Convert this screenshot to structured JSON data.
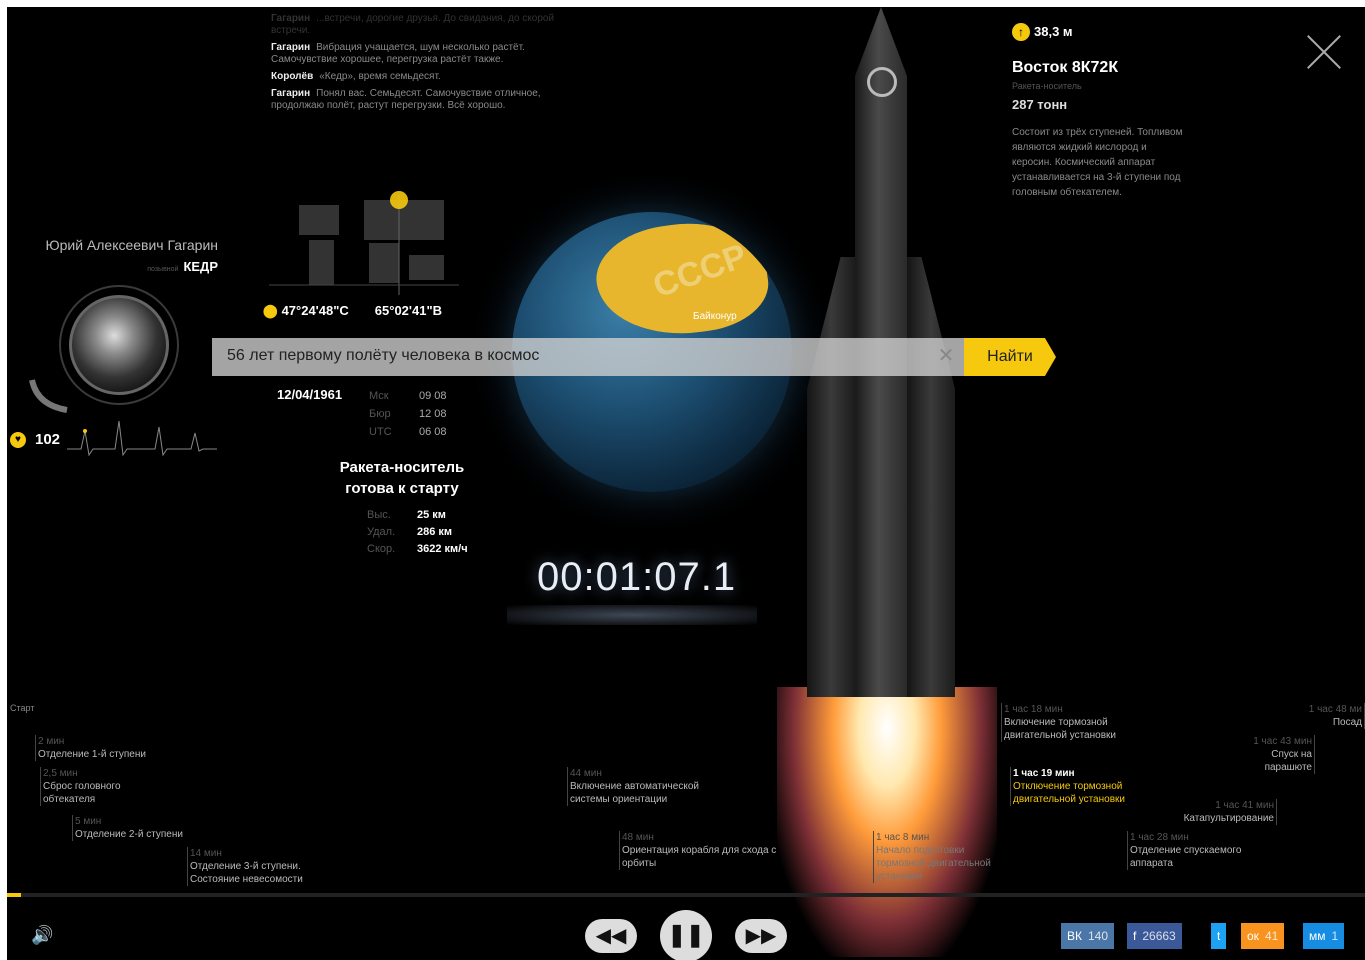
{
  "chat": [
    {
      "who": "Гагарин",
      "text": "...встречи, дорогие друзья. До свидания, до скорой встречи.",
      "faded": true
    },
    {
      "who": "Гагарин",
      "text": "Вибрация учащается, шум несколько растёт. Самочувствие хорошее, перегрузка растёт также.",
      "faded": false
    },
    {
      "who": "Королёв",
      "text": "«Кедр», время семьдесят.",
      "faded": false
    },
    {
      "who": "Гагарин",
      "text": "Понял вас. Семьдесят. Самочувствие отличное, продолжаю полёт, растут перегрузки. Всё хорошо.",
      "faded": false
    }
  ],
  "pilot": {
    "name": "Юрий Алексеевич Гагарин",
    "callsign_label": "позывной",
    "callsign": "КЕДР",
    "heart_rate": "102"
  },
  "coords": {
    "lat": "47°24'48\"С",
    "lon": "65°02'41\"В"
  },
  "globe": {
    "country_label": "СССР",
    "site_label": "Байконур"
  },
  "search": {
    "query": "56 лет первому полёту человека в космос",
    "button": "Найти"
  },
  "time": {
    "date": "12/04/1961",
    "zones": [
      {
        "label": "Мск",
        "value": "09 08"
      },
      {
        "label": "Бюр",
        "value": "12 08"
      },
      {
        "label": "UTC",
        "value": "06 08"
      }
    ]
  },
  "status": {
    "line1": "Ракета-носитель",
    "line2": "готова к старту",
    "stats": [
      {
        "label": "Выс.",
        "value": "25 км"
      },
      {
        "label": "Удал.",
        "value": "286 км"
      },
      {
        "label": "Скор.",
        "value": "3622 км/ч"
      }
    ]
  },
  "timer": "00:01:07.1",
  "rocket": {
    "height": "38,3 м",
    "name": "Восток 8К72К",
    "type": "Ракета-носитель",
    "mass": "287 тонн",
    "description": "Состоит из трёх ступеней. Топливом являются жидкий кислород и керосин. Космический аппарат устанавливается на 3-й ступени под головным обтекателем."
  },
  "timeline": {
    "start": "Старт",
    "events": [
      {
        "time": "2 мин",
        "label": "Отделение 1-й ступени"
      },
      {
        "time": "2,5 мин",
        "label": "Сброс головного обтекателя"
      },
      {
        "time": "5 мин",
        "label": "Отделение 2-й ступени"
      },
      {
        "time": "14 мин",
        "label": "Отделение 3-й ступени. Состояние невесомости"
      },
      {
        "time": "44 мин",
        "label": "Включение автоматической системы ориентации"
      },
      {
        "time": "48 мин",
        "label": "Ориентация корабля для схода с орбиты"
      },
      {
        "time": "1 час 8 мин",
        "label": "Начало подготовки тормозной двигательной установки"
      },
      {
        "time": "1 час 18 мин",
        "label": "Включение тормозной двигательной установки"
      },
      {
        "time": "1 час 19 мин",
        "label": "Отключение тормозной двигательной установки"
      },
      {
        "time": "1 час 28 мин",
        "label": "Отделение спускаемого аппарата"
      },
      {
        "time": "1 час 41 мин",
        "label": "Катапультирование"
      },
      {
        "time": "1 час 43 мин",
        "label": "Спуск на парашюте"
      },
      {
        "time": "1 час 48 ми",
        "label": "Посад"
      }
    ],
    "progress": 0.01
  },
  "controls": {
    "rewind": "◀◀",
    "pause": "❚❚",
    "forward": "▶▶",
    "sound": "🔊"
  },
  "share": [
    {
      "name": "ВК",
      "count": "140",
      "color": "#4a76a8"
    },
    {
      "name": "f",
      "count": "26663",
      "color": "#3b5998"
    },
    {
      "name": "t",
      "count": "",
      "color": "#1da1f2"
    },
    {
      "name": "ок",
      "count": "41",
      "color": "#f7931e"
    },
    {
      "name": "мм",
      "count": "1",
      "color": "#168de2"
    }
  ]
}
